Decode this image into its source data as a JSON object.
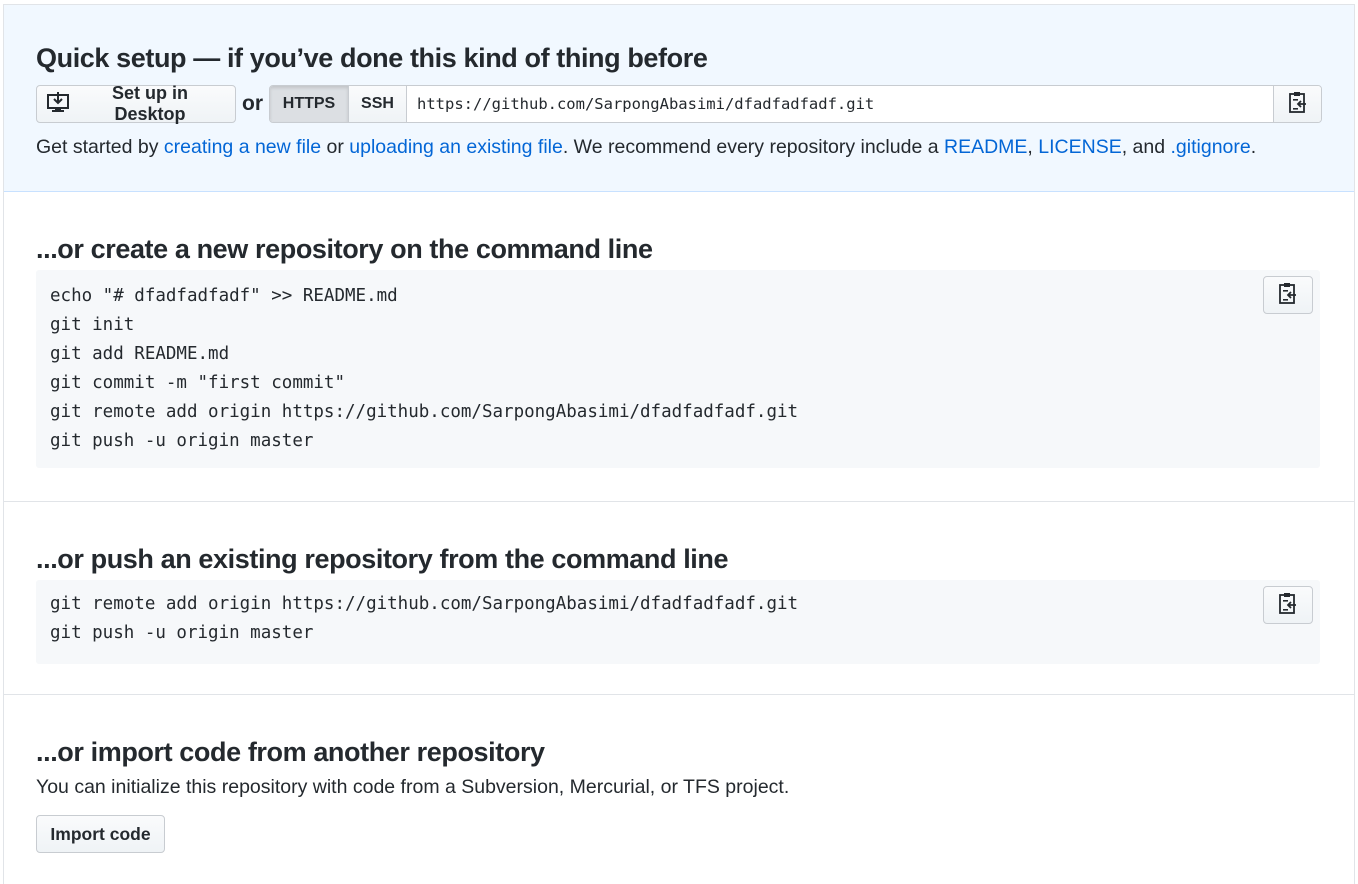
{
  "quick_setup": {
    "title": "Quick setup — if you’ve done this kind of thing before",
    "desktop_button": "Set up in Desktop",
    "or": "or",
    "protocols": [
      "HTTPS",
      "SSH"
    ],
    "selected_protocol": "HTTPS",
    "clone_url": "https://github.com/SarpongAbasimi/dfadfadfadf.git",
    "get_started": {
      "prefix": "Get started by ",
      "link_new_file": "creating a new file",
      "or": " or ",
      "link_upload": "uploading an existing file",
      "middle": ". We recommend every repository include a ",
      "link_readme": "README",
      "comma": ", ",
      "link_license": "LICENSE",
      "and": ", and ",
      "link_gitignore": ".gitignore",
      "end": "."
    }
  },
  "new_repo": {
    "title": "...or create a new repository on the command line",
    "lines": [
      "echo \"# dfadfadfadf\" >> README.md",
      "git init",
      "git add README.md",
      "git commit -m \"first commit\"",
      "git remote add origin https://github.com/SarpongAbasimi/dfadfadfadf.git",
      "git push -u origin master"
    ]
  },
  "push_repo": {
    "title": "...or push an existing repository from the command line",
    "lines": [
      "git remote add origin https://github.com/SarpongAbasimi/dfadfadfadf.git",
      "git push -u origin master"
    ]
  },
  "import_repo": {
    "title": "...or import code from another repository",
    "description": "You can initialize this repository with code from a Subversion, Mercurial, or TFS project.",
    "button": "Import code"
  },
  "icons": {
    "desktop": "desktop-download-icon",
    "clipboard": "clipboard-icon"
  }
}
